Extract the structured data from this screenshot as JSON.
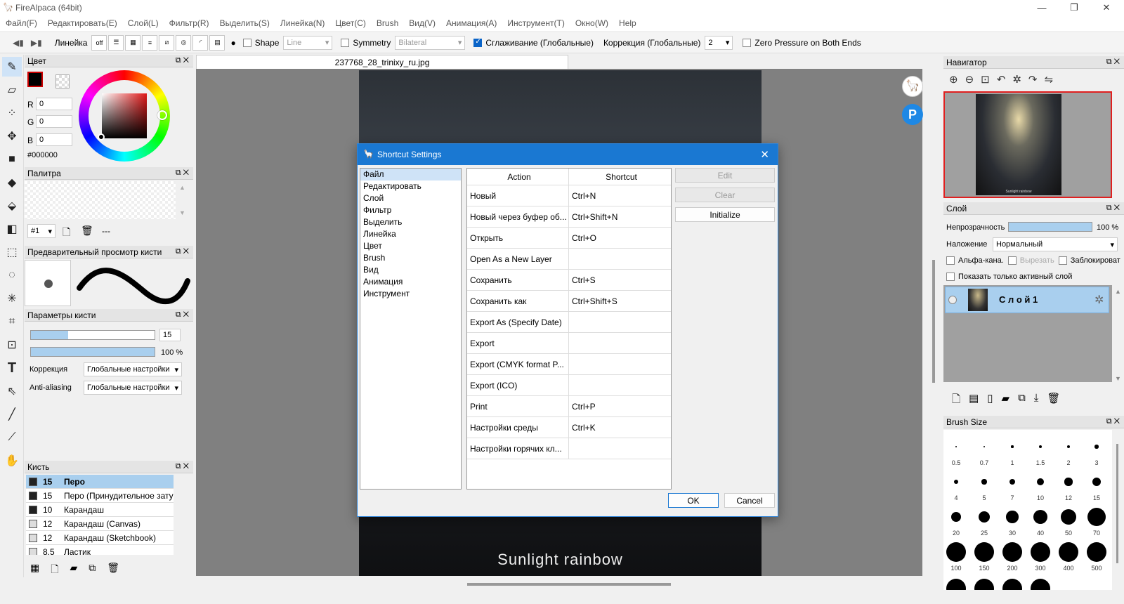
{
  "window": {
    "title": "FireAlpaca (64bit)"
  },
  "menu": [
    "Файл(F)",
    "Редактировать(E)",
    "Слой(L)",
    "Фильтр(R)",
    "Выделить(S)",
    "Линейка(N)",
    "Цвет(C)",
    "Brush",
    "Вид(V)",
    "Анимация(A)",
    "Инструмент(T)",
    "Окно(W)",
    "Help"
  ],
  "toolbar": {
    "ruler_label": "Линейка",
    "off_label": "off",
    "shape_label": "Shape",
    "shape_value": "Line",
    "symmetry_label": "Symmetry",
    "symmetry_value": "Bilateral",
    "smoothing_label": "Сглаживание (Глобальные)",
    "correction_label": "Коррекция (Глобальные)",
    "correction_value": "2",
    "zero_pressure_label": "Zero Pressure on Both Ends"
  },
  "color_panel": {
    "title": "Цвет",
    "r_label": "R",
    "r": "0",
    "g_label": "G",
    "g": "0",
    "b_label": "B",
    "b": "0",
    "hex": "#000000",
    "fg": "#000000",
    "ring_accent": "#d01818"
  },
  "palette_panel": {
    "title": "Палитра",
    "index": "#1",
    "dash": "---"
  },
  "brush_preview": {
    "title": "Предварительный просмотр кисти"
  },
  "brush_params": {
    "title": "Параметры кисти",
    "size_value": "15",
    "size_fraction": 0.3,
    "opacity_value": "100 %",
    "opacity_fraction": 1.0,
    "correction_label": "Коррекция",
    "correction_value": "Глобальные настройки",
    "aa_label": "Anti-aliasing",
    "aa_value": "Глобальные настройки"
  },
  "brush_list": {
    "title": "Кисть",
    "items": [
      {
        "size": "15",
        "name": "Перо",
        "sel": true
      },
      {
        "size": "15",
        "name": "Перо (Принудительное зату"
      },
      {
        "size": "10",
        "name": "Карандаш"
      },
      {
        "size": "12",
        "name": "Карандаш (Canvas)"
      },
      {
        "size": "12",
        "name": "Карандаш (Sketchbook)"
      },
      {
        "size": "8.5",
        "name": "Ластик"
      }
    ]
  },
  "document": {
    "tab": "237768_28_trinixy_ru.jpg",
    "caption": "Sunlight rainbow"
  },
  "navigator": {
    "title": "Навигатор",
    "thumb_caption": "Sunlight rainbow"
  },
  "layer_panel": {
    "title": "Слой",
    "opacity_label": "Непрозрачность",
    "opacity_value": "100 %",
    "blend_label": "Наложение",
    "blend_value": "Нормальный",
    "alpha_label": "Альфа-кана.",
    "clip_label": "Вырезать",
    "lock_label": "Заблокироват",
    "show_active_label": "Показать только активный слой",
    "layer_name": "С л о й 1"
  },
  "brush_size_panel": {
    "title": "Brush Size",
    "sizes": [
      "0.5",
      "0.7",
      "1",
      "1.5",
      "2",
      "3",
      "4",
      "5",
      "7",
      "10",
      "12",
      "15",
      "20",
      "25",
      "30",
      "40",
      "50",
      "70",
      "100",
      "150",
      "200",
      "300",
      "400",
      "500"
    ]
  },
  "dialog": {
    "title": "Shortcut Settings",
    "categories": [
      "Файл",
      "Редактировать",
      "Слой",
      "Фильтр",
      "Выделить",
      "Линейка",
      "Цвет",
      "Brush",
      "Вид",
      "Анимация",
      "Инструмент"
    ],
    "col_action": "Action",
    "col_shortcut": "Shortcut",
    "rows": [
      {
        "action": "Новый",
        "shortcut": "Ctrl+N"
      },
      {
        "action": "Новый через буфер об...",
        "shortcut": "Ctrl+Shift+N"
      },
      {
        "action": "Открыть",
        "shortcut": "Ctrl+O"
      },
      {
        "action": "Open As a New Layer",
        "shortcut": ""
      },
      {
        "action": "Сохранить",
        "shortcut": "Ctrl+S"
      },
      {
        "action": "Сохранить как",
        "shortcut": "Ctrl+Shift+S"
      },
      {
        "action": "Export As (Specify Date)",
        "shortcut": ""
      },
      {
        "action": "Export",
        "shortcut": ""
      },
      {
        "action": "Export (CMYK format P...",
        "shortcut": ""
      },
      {
        "action": "Export (ICO)",
        "shortcut": ""
      },
      {
        "action": "Print",
        "shortcut": "Ctrl+P"
      },
      {
        "action": "Настройки среды",
        "shortcut": "Ctrl+K"
      },
      {
        "action": "Настройки горячих кл...",
        "shortcut": ""
      }
    ],
    "edit_label": "Edit",
    "clear_label": "Clear",
    "initialize_label": "Initialize",
    "ok_label": "OK",
    "cancel_label": "Cancel"
  }
}
